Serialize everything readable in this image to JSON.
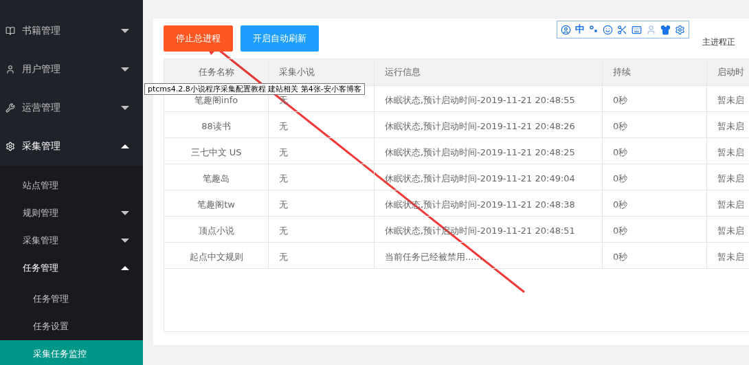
{
  "sidebar": {
    "items": [
      {
        "label": "书籍管理",
        "expanded": false
      },
      {
        "label": "用户管理",
        "expanded": false
      },
      {
        "label": "运营管理",
        "expanded": false
      },
      {
        "label": "采集管理",
        "expanded": true,
        "children": [
          {
            "label": "站点管理",
            "selected": false
          },
          {
            "label": "规则管理",
            "expanded": false,
            "selected": false
          },
          {
            "label": "采集管理",
            "expanded": false,
            "selected": false
          },
          {
            "label": "任务管理",
            "expanded": true,
            "selected": false,
            "children": [
              {
                "label": "任务管理",
                "selected": false
              },
              {
                "label": "任务设置",
                "selected": false
              },
              {
                "label": "采集任务监控",
                "selected": true
              }
            ]
          }
        ]
      }
    ]
  },
  "buttons": [
    {
      "label": "停止总进程",
      "kind": "danger"
    },
    {
      "label": "开启自动刷新",
      "kind": "primary"
    }
  ],
  "ime_toolbar": {
    "language": "中"
  },
  "status_text": "主进程正",
  "tooltip": "ptcms4.2.8小说程序采集配置教程 建站相关 第4张-安小客博客",
  "table": {
    "columns": [
      "任务名称",
      "采集小说",
      "运行信息",
      "持续",
      "启动时"
    ],
    "rows": [
      [
        "笔趣阁info",
        "无",
        "休眠状态,预计启动时间-2019-11-21 20:48:55",
        "0秒",
        "暂未启"
      ],
      [
        "88读书",
        "无",
        "休眠状态,预计启动时间-2019-11-21 20:48:26",
        "0秒",
        "暂未启"
      ],
      [
        "三七中文 US",
        "无",
        "休眠状态,预计启动时间-2019-11-21 20:48:25",
        "0秒",
        "暂未启"
      ],
      [
        "笔趣岛",
        "无",
        "休眠状态,预计启动时间-2019-11-21 20:49:04",
        "0秒",
        "暂未启"
      ],
      [
        "笔趣阁tw",
        "无",
        "休眠状态,预计启动时间-2019-11-21 20:48:38",
        "0秒",
        "暂未启"
      ],
      [
        "顶点小说",
        "无",
        "休眠状态,预计启动时间-2019-11-21 20:48:51",
        "0秒",
        "暂未启"
      ],
      [
        "起点中文规则",
        "无",
        "当前任务已经被禁用......",
        "0秒",
        "暂未启"
      ]
    ]
  }
}
